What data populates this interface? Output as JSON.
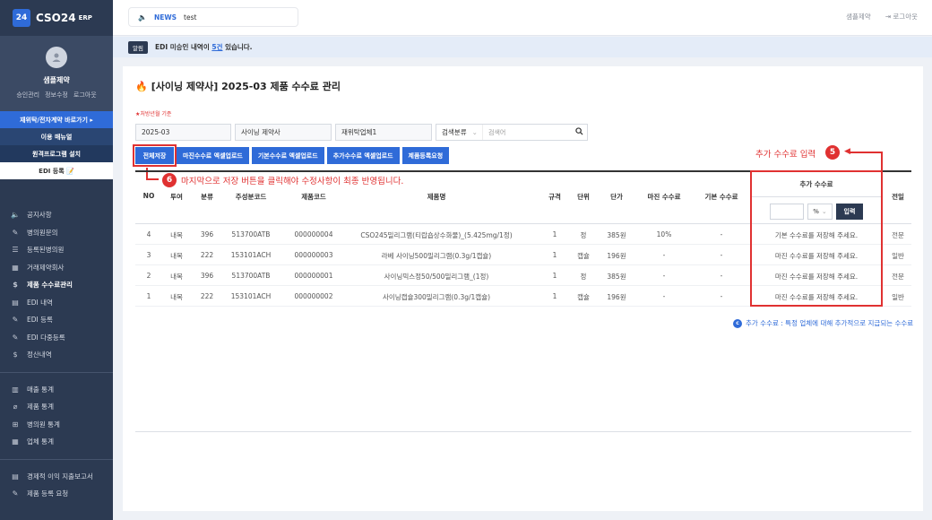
{
  "brand": {
    "badge": "24",
    "name": "CSO24",
    "sub": "ERP"
  },
  "profile": {
    "name": "샘플제약",
    "links": [
      "승인관리",
      "정보수정",
      "로그아웃"
    ]
  },
  "quick": [
    "재위탁/전자계약 바로가기 ▸",
    "이용 매뉴얼",
    "원격프로그램 설치",
    "EDI 등록 📝"
  ],
  "menu1": [
    {
      "icon": "🔈",
      "label": "공지사항"
    },
    {
      "icon": "✎",
      "label": "병의원문의"
    },
    {
      "icon": "☰",
      "label": "등록된병의원"
    },
    {
      "icon": "▦",
      "label": "거래제약회사"
    },
    {
      "icon": "$",
      "label": "제품 수수료관리",
      "active": true
    },
    {
      "icon": "▤",
      "label": "EDI 내역"
    },
    {
      "icon": "✎",
      "label": "EDI 등록"
    },
    {
      "icon": "✎",
      "label": "EDI 다중등록"
    },
    {
      "icon": "$",
      "label": "정산내역"
    }
  ],
  "menu2": [
    {
      "icon": "▥",
      "label": "매출 통계"
    },
    {
      "icon": "⌀",
      "label": "제품 통계"
    },
    {
      "icon": "⊞",
      "label": "병의원 통계"
    },
    {
      "icon": "▦",
      "label": "업체 통계"
    }
  ],
  "menu3": [
    {
      "icon": "▤",
      "label": "경제적 이익 지출보고서"
    },
    {
      "icon": "✎",
      "label": "제품 등록 요청"
    }
  ],
  "topbar": {
    "news_tag": "NEWS",
    "news_text": "test",
    "company": "샘플제약",
    "logout": "로그아웃"
  },
  "alert": {
    "badge": "알림",
    "pre": "EDI 미승인 내역이 ",
    "link": "5건",
    "post": " 있습니다."
  },
  "page": {
    "title": "[사이닝 제약사] 2025-03 제품 수수료 관리",
    "note": "★처방년월 기준"
  },
  "filters": {
    "month": "2025-03",
    "company": "사이닝 제약사",
    "vendor": "재위탁업체1",
    "search_type": "검색분류",
    "search_placeholder": "검색어"
  },
  "buttons": [
    "전체저장",
    "마진수수료 엑셀업로드",
    "기본수수료 엑셀업로드",
    "추가수수료 엑셀업로드",
    "제품등록요청"
  ],
  "annotations": {
    "five_label": "추가 수수료 입력",
    "five_num": "5",
    "six_num": "6",
    "six_label": "마지막으로 저장 버튼을 클릭해야 수정사항이 최종 반영됩니다."
  },
  "table": {
    "headers": [
      "NO",
      "투여",
      "분류",
      "주성분코드",
      "제품코드",
      "제품명",
      "규격",
      "단위",
      "단가",
      "마진 수수료",
      "기본 수수료",
      "추가 수수료",
      "전일"
    ],
    "unit_select": "%",
    "apply_label": "입력",
    "rows": [
      [
        "4",
        "내복",
        "396",
        "513700ATB",
        "000000004",
        "CSO245밀리그램(티랍숍상수화물)_(5.425mg/1정)",
        "1",
        "정",
        "385원",
        "10%",
        "-",
        "기본 수수료를 저장해 주세요.",
        "전문"
      ],
      [
        "3",
        "내복",
        "222",
        "153101ACH",
        "000000003",
        "라베 사이닝500밀리그램(0.3g/1캡슐)",
        "1",
        "캡슐",
        "196원",
        "-",
        "-",
        "마진 수수료를 저장해 주세요.",
        "일반"
      ],
      [
        "2",
        "내복",
        "396",
        "513700ATB",
        "000000001",
        "사이닝믹스정50/500밀리그램_(1정)",
        "1",
        "정",
        "385원",
        "-",
        "-",
        "마진 수수료를 저장해 주세요.",
        "전문"
      ],
      [
        "1",
        "내복",
        "222",
        "153101ACH",
        "000000002",
        "사이닝캡슐300밀리그램(0.3g/1캡슐)",
        "1",
        "캡슐",
        "196원",
        "-",
        "-",
        "마진 수수료를 저장해 주세요.",
        "일반"
      ]
    ]
  },
  "legend": {
    "badge": "c",
    "text": "추가 수수료 : 특정 업체에 대해 추가적으로 지급되는 수수료"
  }
}
